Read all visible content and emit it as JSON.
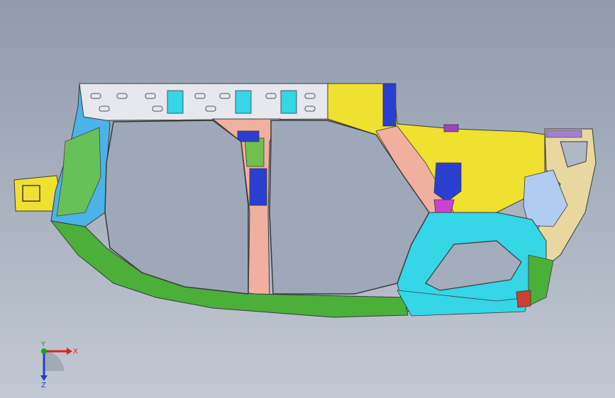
{
  "viewport": {
    "background_top": "#8f9aab",
    "background_bottom": "#c3c9d3"
  },
  "model": {
    "description_icon": "car-body-side-frame-model",
    "part_colors": {
      "roof_rail": "#e6e8ee",
      "front_pillar": "#4bb3e8",
      "rocker": "#4caf3a",
      "center_pillar": "#f0b0a0",
      "rear_quarter": "#f0e030",
      "rear_wheelhouse": "#35d6e6",
      "bracket_blue": "#2a3fd0",
      "bracket_magenta": "#d040d0",
      "rear_pillar_tan": "#e8d8a0",
      "wheel_arch_liner": "#b0ccf0",
      "outline": "#3a3a3a"
    }
  },
  "triad": {
    "x_label": "X",
    "y_label": "Y",
    "z_label": "Z",
    "x_color": "#e02020",
    "y_color": "#20a020",
    "z_color": "#2040d0"
  }
}
